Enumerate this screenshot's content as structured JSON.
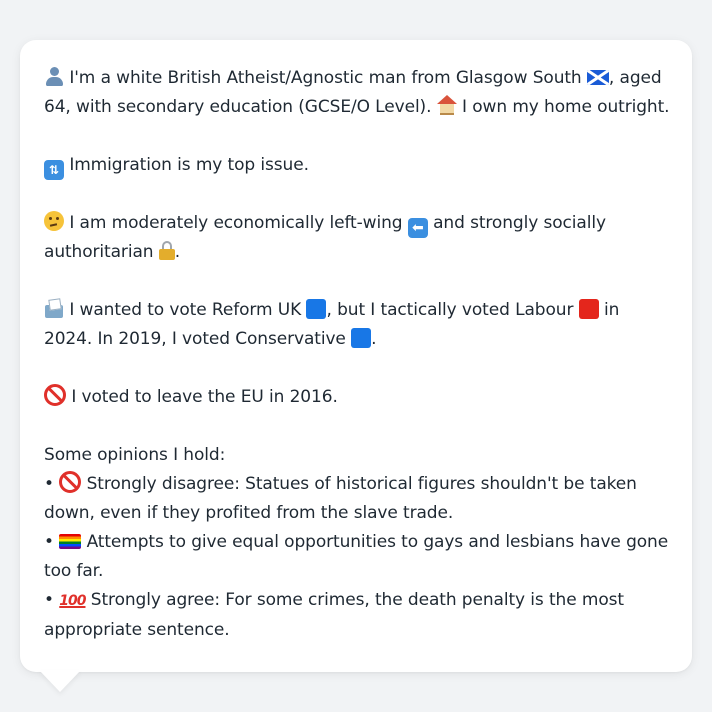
{
  "profile": {
    "identity": {
      "part1": "I'm a white British Atheist/Agnostic man from Glasgow South",
      "part2": ", aged 64, with secondary education (GCSE/O Level).",
      "part3": "I own my home outright.",
      "icons": [
        "person-icon",
        "scotland-flag-icon",
        "house-icon"
      ]
    },
    "top_issue": {
      "text": "Immigration is my top issue.",
      "icon": "passport-control-icon"
    },
    "ideology": {
      "part1": "I am moderately economically left-wing",
      "part2": "and strongly socially authoritarian",
      "part3": ".",
      "icons": [
        "thinking-face-icon",
        "left-arrow-icon",
        "lock-icon"
      ]
    },
    "voting": {
      "part1": "I wanted to vote Reform UK",
      "part2": ", but I tactically voted Labour",
      "part3": "in 2024. In 2019, I voted Conservative",
      "part4": ".",
      "icons": [
        "ballot-box-icon",
        "blue-square-icon",
        "red-square-icon",
        "blue-square-icon"
      ]
    },
    "brexit": {
      "text": "I voted to leave the EU in 2016.",
      "icon": "prohibited-icon"
    },
    "opinions": {
      "heading": "Some opinions I hold:",
      "bullet": "•",
      "items": [
        {
          "icon": "prohibited-icon",
          "text": "Strongly disagree: Statues of historical figures shouldn't be taken down, even if they profited from the slave trade."
        },
        {
          "icon": "rainbow-flag-icon",
          "text": "Attempts to give equal opportunities to gays and lesbians have gone too far."
        },
        {
          "icon": "hundred-points-icon",
          "text": "Strongly agree: For some crimes, the death penalty is the most appropriate sentence."
        }
      ]
    }
  },
  "colors": {
    "bubble_background": "#ffffff",
    "page_background": "#f1f3f5",
    "text": "#1f2933",
    "reform_blue": "#1877e6",
    "labour_red": "#e4261c",
    "prohibited_red": "#e0302a"
  }
}
